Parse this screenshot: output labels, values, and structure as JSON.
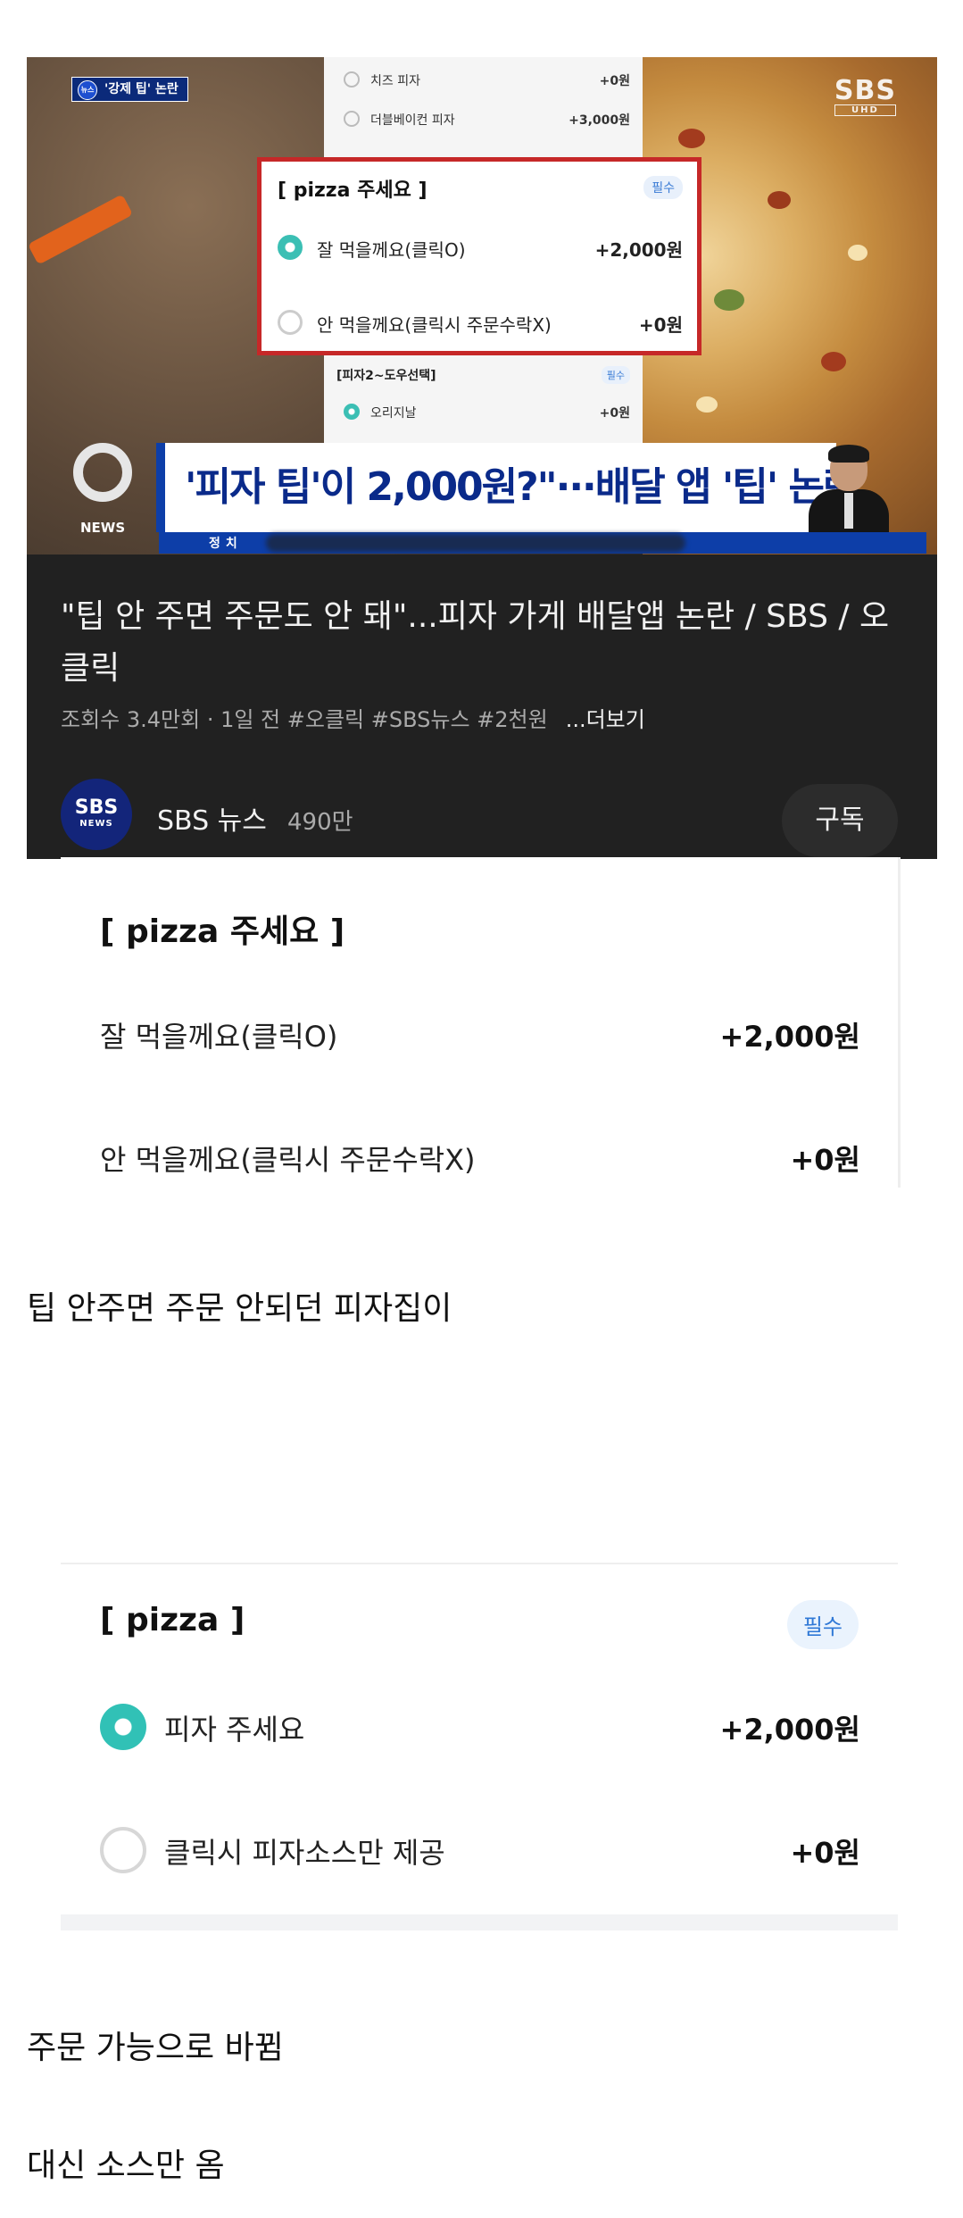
{
  "video": {
    "thumbnail": {
      "badge": "'강제 팁' 논란",
      "badge_small": "뉴스",
      "channel_logo": "SBS",
      "channel_logo_sub": "UHD",
      "strip_rows": [
        {
          "label": "치즈 피자",
          "amount": "+0원",
          "selected": false
        },
        {
          "label": "더블베이컨 피자",
          "amount": "+3,000원",
          "selected": false
        }
      ],
      "strip_section": {
        "title": "[피자2~도우선택]",
        "tag": "필수"
      },
      "strip_row_bottom": {
        "label": "오리지날",
        "amount": "+0원",
        "selected": true
      },
      "zoom_box": {
        "title": "[ pizza 주세요 ]",
        "tag": "필수",
        "options": [
          {
            "label": "잘 먹을께요(클릭O)",
            "amount": "+2,000원",
            "selected": true
          },
          {
            "label": "안 먹을께요(클릭시 주문수락X)",
            "amount": "+0원",
            "selected": false
          }
        ]
      },
      "headline": "'피자 팁'이 2,000원?\"···배달 앱 '팁' 논란",
      "news_label": "NEWS",
      "section": "정치"
    },
    "title": "\"팁 안 주면 주문도 안 돼\"...피자 가게 배달앱 논란 / SBS / 오클릭",
    "meta": "조회수 3.4만회 · 1일 전  #오클릭 #SBS뉴스 #2천원",
    "more": "...더보기",
    "channel": {
      "avatar_top": "SBS",
      "avatar_bottom": "NEWS",
      "name": "SBS 뉴스",
      "subscribers": "490만"
    },
    "subscribe_label": "구독"
  },
  "panel1": {
    "title": "[ pizza 주세요 ]",
    "options": [
      {
        "label": "잘 먹을께요(클릭O)",
        "amount": "+2,000원"
      },
      {
        "label": "안 먹을께요(클릭시 주문수락X)",
        "amount": "+0원"
      }
    ]
  },
  "caption1": "팁 안주면 주문 안되던 피자집이",
  "panel2": {
    "title": "[ pizza ]",
    "tag": "필수",
    "options": [
      {
        "label": "피자 주세요",
        "amount": "+2,000원",
        "selected": true
      },
      {
        "label": "클릭시 피자소스만 제공",
        "amount": "+0원",
        "selected": false
      }
    ]
  },
  "caption2": "주문 가능으로 바뀜",
  "caption3": "대신 소스만 옴",
  "colors": {
    "accent_teal": "#31c1b6",
    "red_border": "#c62828",
    "news_blue": "#0d3ea8",
    "tag_blue": "#2f78d6"
  }
}
